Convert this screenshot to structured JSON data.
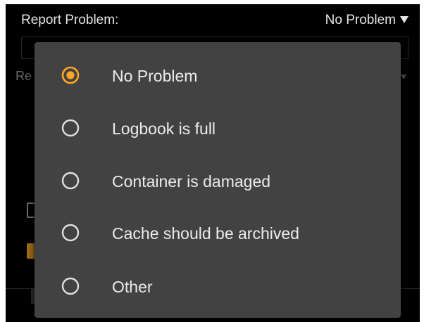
{
  "header": {
    "report_label": "Report Problem:",
    "report_value": "No Problem",
    "caret_icon": "triangle-down-icon"
  },
  "background": {
    "row2_label_partial": "Re"
  },
  "dialog": {
    "selected_index": 0,
    "options": [
      {
        "label": "No Problem",
        "selected": true
      },
      {
        "label": "Logbook is full",
        "selected": false
      },
      {
        "label": "Container is damaged",
        "selected": false
      },
      {
        "label": "Cache should be archived",
        "selected": false
      },
      {
        "label": "Other",
        "selected": false
      }
    ]
  },
  "colors": {
    "accent": "#ffa726",
    "radio_unselected": "#e0e0e0",
    "dialog_bg": "#424242",
    "app_bg": "#000000",
    "text": "#ececec"
  }
}
